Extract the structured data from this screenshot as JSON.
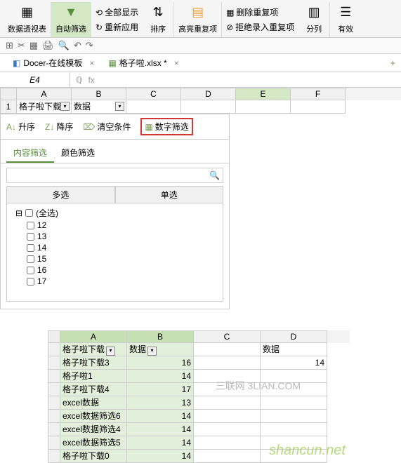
{
  "ribbon": {
    "pivot": "数据透视表",
    "autofilter": "自动筛选",
    "showall": "全部显示",
    "reapply": "重新应用",
    "sort": "排序",
    "highlight": "高亮重复项",
    "deldup": "删除重复项",
    "rejectdup": "拒绝录入重复项",
    "split": "分列",
    "valid": "有效"
  },
  "tabs": {
    "docer": "Docer-在线模板",
    "file": "格子啦.xlsx *"
  },
  "namebox": "E4",
  "fx": "fx",
  "cols": [
    "A",
    "B",
    "C",
    "D",
    "E",
    "F"
  ],
  "row1": {
    "num": "1",
    "A": "格子啦下载",
    "B": "数据"
  },
  "filter": {
    "asc": "升序",
    "desc": "降序",
    "clear": "清空条件",
    "numfilter": "数字筛选",
    "tab1": "内容筛选",
    "tab2": "颜色筛选",
    "multi": "多选",
    "single": "单选",
    "all": "(全选)",
    "items": [
      "12",
      "13",
      "14",
      "15",
      "16",
      "17"
    ]
  },
  "sheet2": {
    "cols": [
      "A",
      "B",
      "C",
      "D"
    ],
    "hdr": {
      "A": "格子啦下载",
      "B": "数据",
      "D": "数据"
    },
    "rows": [
      {
        "A": "格子啦下载3",
        "B": "16",
        "D": "14"
      },
      {
        "A": "格子啦1",
        "B": "14"
      },
      {
        "A": "格子啦下载4",
        "B": "17"
      },
      {
        "A": "excel数据",
        "B": "13"
      },
      {
        "A": "excel数据筛选6",
        "B": "14"
      },
      {
        "A": "excel数据筛选4",
        "B": "14"
      },
      {
        "A": "excel数据筛选5",
        "B": "14"
      },
      {
        "A": "格子啦下载0",
        "B": "14"
      }
    ]
  },
  "wm": "shancun.net",
  "wm2": "三联网 3LIAN.COM"
}
